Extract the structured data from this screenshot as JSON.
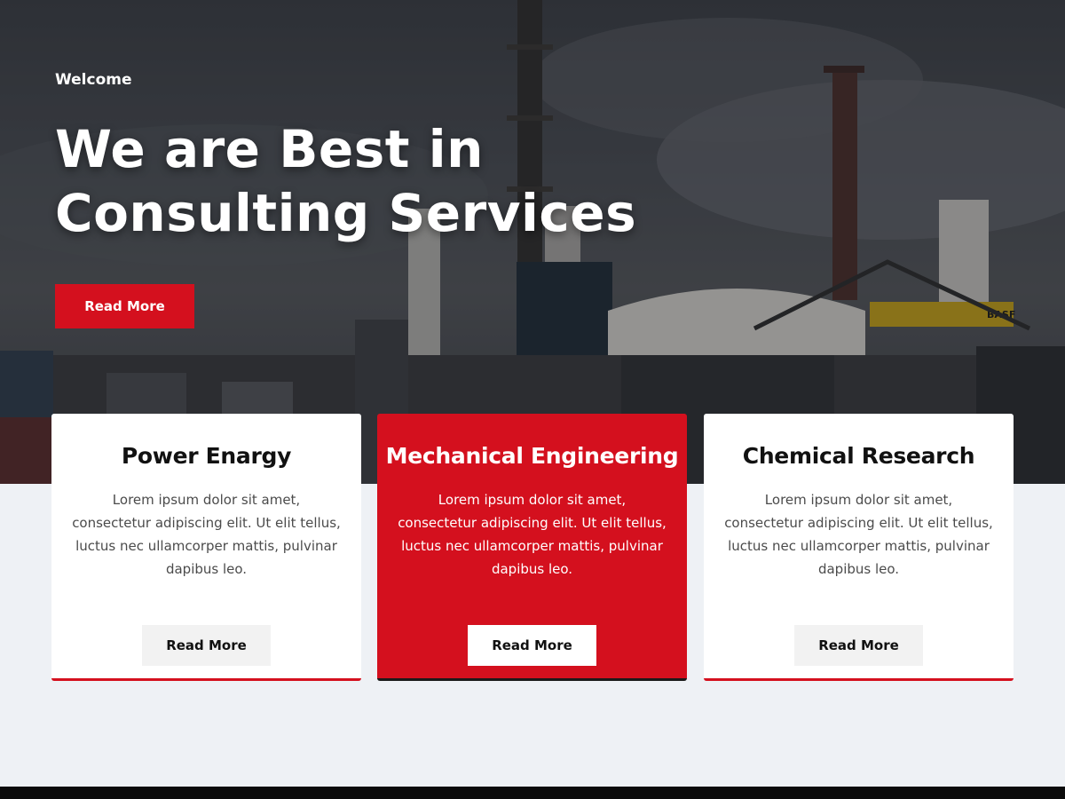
{
  "hero": {
    "welcome": "Welcome",
    "title": "We are Best in Consulting Services",
    "button_label": "Read More",
    "sign_text": "BASF"
  },
  "cards": [
    {
      "title": "Power Enargy",
      "text": "Lorem ipsum dolor sit amet, consectetur adipiscing elit. Ut elit tellus, luctus nec ullamcorper mattis, pulvinar dapibus leo.",
      "button_label": "Read More",
      "active": false
    },
    {
      "title": "Mechanical Engineering",
      "text": "Lorem ipsum dolor sit amet, consectetur adipiscing elit. Ut elit tellus, luctus nec ullamcorper mattis, pulvinar dapibus leo.",
      "button_label": "Read More",
      "active": true
    },
    {
      "title": "Chemical Research",
      "text": "Lorem ipsum dolor sit amet, consectetur adipiscing elit. Ut elit tellus, luctus nec ullamcorper mattis, pulvinar dapibus leo.",
      "button_label": "Read More",
      "active": false
    }
  ],
  "colors": {
    "accent": "#d4101e",
    "page_background": "#eef1f5",
    "footer": "#0b0b0b"
  }
}
